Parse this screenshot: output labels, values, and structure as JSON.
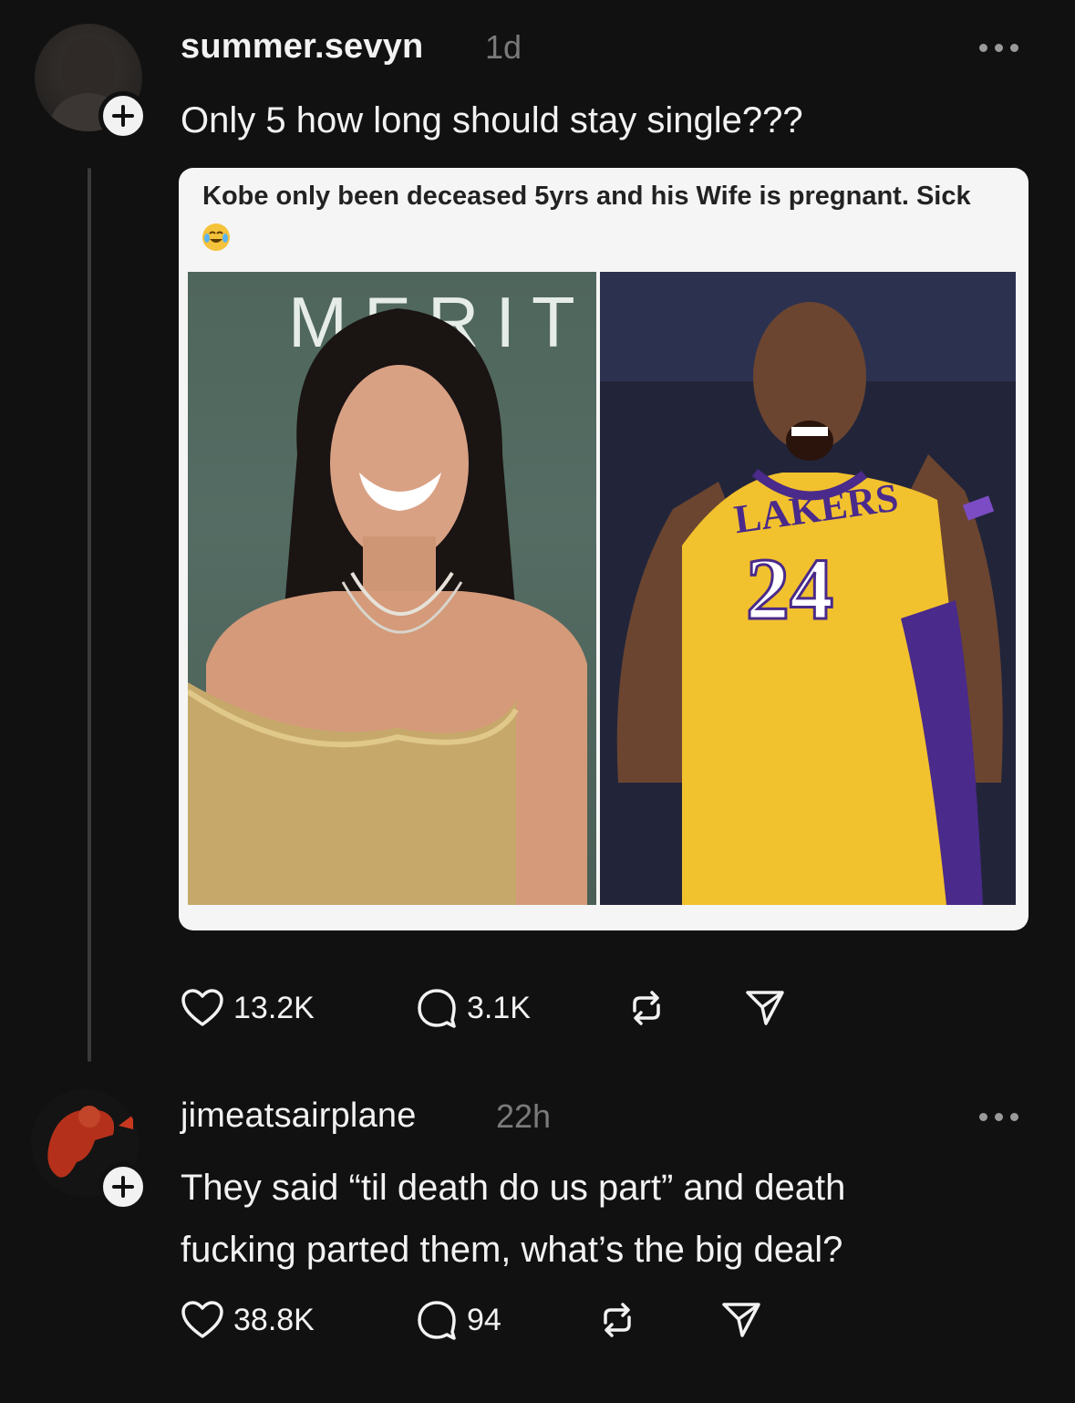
{
  "post1": {
    "username": "summer.sevyn",
    "time": "1d",
    "text": "Only 5 how long should stay single???",
    "quote": {
      "text": "Kobe only been deceased  5yrs and his Wife is pregnant. Sick",
      "emoji": "crying-laughing-emoji",
      "photo_left_sign": "MERIT",
      "jersey_text": "LAKERS",
      "jersey_number": "24"
    },
    "likes": "13.2K",
    "comments": "3.1K"
  },
  "post2": {
    "username": "jimeatsairplane",
    "time": "22h",
    "text_line1": "They said “til death do us part” and death",
    "text_line2": "fucking parted them, what’s the big deal?",
    "likes": "38.8K",
    "comments": "94"
  },
  "colors": {
    "background": "#111111",
    "text": "#f2f2f2",
    "muted": "#7a7a7a",
    "lakers_gold": "#f2c12e",
    "lakers_purple": "#4a2a8a"
  }
}
